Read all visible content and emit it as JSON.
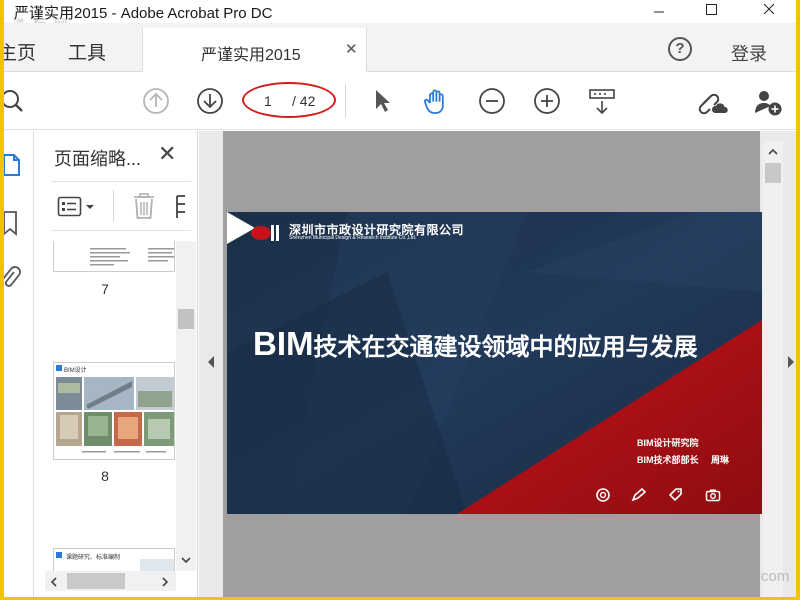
{
  "window": {
    "title": "严谨实用2015 - Adobe Acrobat Pro DC",
    "watermark_top": "道 标 网",
    "watermark_bottom": "com"
  },
  "tabs": {
    "home": "主页",
    "tools": "工具",
    "document": "严谨实用2015",
    "help": "?",
    "login": "登录"
  },
  "toolbar": {
    "page_current": "1",
    "page_total": "/ 42"
  },
  "thumbnail_panel": {
    "title": "页面缩略...",
    "thumbs": [
      {
        "label": "7"
      },
      {
        "label": "8",
        "heading": "BIM设计"
      },
      {
        "heading": "课题研究、标准编制"
      }
    ]
  },
  "slide": {
    "logo_text": "深圳市市政设计研究院有限公司",
    "logo_sub": "Shenzhen Municipal Design & Research Institute Co.,Ltd.",
    "title_prefix": "BIM",
    "title_rest": "技术在交通建设领域中的应用与发展",
    "line1": "BIM设计研究院",
    "line2_role": "BIM技术部部长",
    "line2_name": "周琳"
  },
  "colors": {
    "frame": "#f2c400",
    "accent_blue": "#2b7bd6",
    "annotation_red": "#d41c1c",
    "slide_navy": "#1f3550",
    "slide_red": "#a40f14"
  }
}
